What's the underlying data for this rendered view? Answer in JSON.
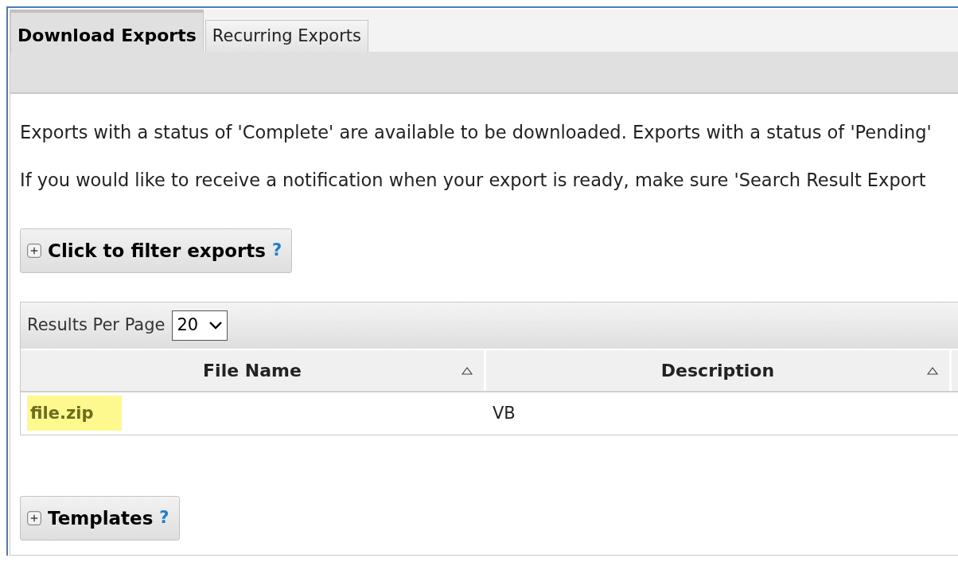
{
  "tabs": [
    {
      "label": "Download Exports",
      "selected": true
    },
    {
      "label": "Recurring Exports",
      "selected": false
    }
  ],
  "intro": [
    "Exports with a status of 'Complete' are available to be downloaded. Exports with a status of 'Pending'",
    "If you would like to receive a notification when your export is ready, make sure 'Search Result Export"
  ],
  "filter_panel": {
    "label": "Click to filter exports",
    "help": "?"
  },
  "grid": {
    "results_per_page_label": "Results Per Page",
    "results_per_page": "20",
    "columns": [
      {
        "label": "File Name"
      },
      {
        "label": "Description"
      }
    ],
    "rows": [
      {
        "cells": [
          {
            "text": "file.zip",
            "kind": "link",
            "highlighted": true
          },
          {
            "text": "VB",
            "kind": "text",
            "highlighted": false
          }
        ]
      }
    ]
  },
  "templates_panel": {
    "label": "Templates",
    "help": "?"
  }
}
